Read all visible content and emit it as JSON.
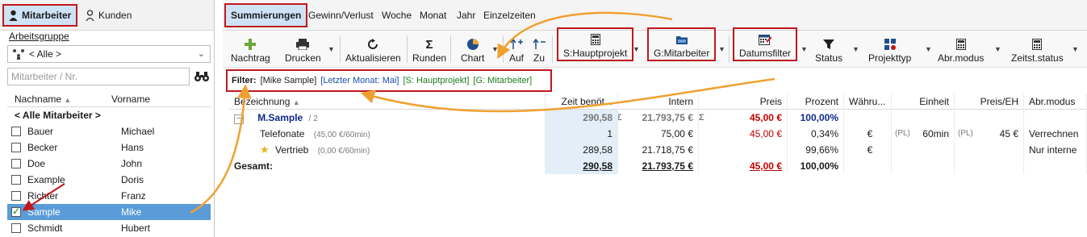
{
  "left": {
    "tabs": {
      "employees": "Mitarbeiter",
      "customers": "Kunden"
    },
    "workgroup_label": "Arbeitsgruppe",
    "workgroup_value": "< Alle >",
    "search_placeholder": "Mitarbeiter / Nr.",
    "columns": {
      "lastname": "Nachname",
      "firstname": "Vorname"
    },
    "all_label": "< Alle Mitarbeiter >",
    "rows": [
      {
        "last": "Bauer",
        "first": "Michael"
      },
      {
        "last": "Becker",
        "first": "Hans"
      },
      {
        "last": "Doe",
        "first": "John"
      },
      {
        "last": "Example",
        "first": "Doris"
      },
      {
        "last": "Richter",
        "first": "Franz"
      },
      {
        "last": "Sample",
        "first": "Mike"
      },
      {
        "last": "Schmidt",
        "first": "Hubert"
      }
    ]
  },
  "right": {
    "tabs": [
      "Summierungen",
      "Gewinn/Verlust",
      "Woche",
      "Monat",
      "Jahr",
      "Einzelzeiten"
    ],
    "toolbar": {
      "nachtrag": "Nachtrag",
      "drucken": "Drucken",
      "aktualisieren": "Aktualisieren",
      "runden": "Runden",
      "chart": "Chart",
      "auf": "Auf",
      "zu": "Zu",
      "hauptprojekt": "S:Hauptprojekt",
      "mitarbeiter": "G:Mitarbeiter",
      "datumsfilter": "Datumsfilter",
      "status": "Status",
      "projekttyp": "Projekttyp",
      "abrmodus": "Abr.modus",
      "zeitststatus": "Zeitst.status"
    },
    "filter": {
      "label": "Filter:",
      "person": "[Mike Sample]",
      "month": "[Letzter Monat: Mai]",
      "main": "[S: Hauptprojekt]",
      "group": "[G: Mitarbeiter]"
    },
    "columns": {
      "name": "Bezeichnung",
      "time": "Zeit benöt...",
      "intern": "Intern",
      "price": "Preis",
      "percent": "Prozent",
      "currency": "Währu...",
      "unit": "Einheit",
      "price_unit": "Preis/EH",
      "mode": "Abr.modus"
    },
    "rows": {
      "sample": {
        "name": "M.Sample",
        "count": "/ 2",
        "time": "290,58",
        "sigma": "Σ",
        "intern": "21.793,75 €",
        "price": "45,00 €",
        "percent": "100,00%"
      },
      "tel": {
        "name": "Telefonate",
        "rate": "(45,00 €/60min)",
        "time": "1",
        "intern": "75,00 €",
        "price": "45,00 €",
        "percent": "0,34%",
        "currency": "€",
        "pl1": "(PL)",
        "unit": "60min",
        "pl2": "(PL)",
        "price_unit": "45 €",
        "mode": "Verrechnen"
      },
      "vertrieb": {
        "name": "Vertrieb",
        "rate": "(0,00 €/60min)",
        "time": "289,58",
        "intern": "21.718,75 €",
        "percent": "99,66%",
        "currency": "€",
        "mode": "Nur interne"
      },
      "total": {
        "name": "Gesamt:",
        "time": "290,58",
        "intern": "21.793,75 €",
        "price": "45,00 €",
        "percent": "100,00%"
      }
    }
  },
  "colors": {
    "highlight_box": "#c0171c",
    "arrow": "#f0a030",
    "selection": "#5a9bd8",
    "tab_active": "#cfe3f7",
    "red_value": "#c00000",
    "navy_text": "#10288a"
  }
}
